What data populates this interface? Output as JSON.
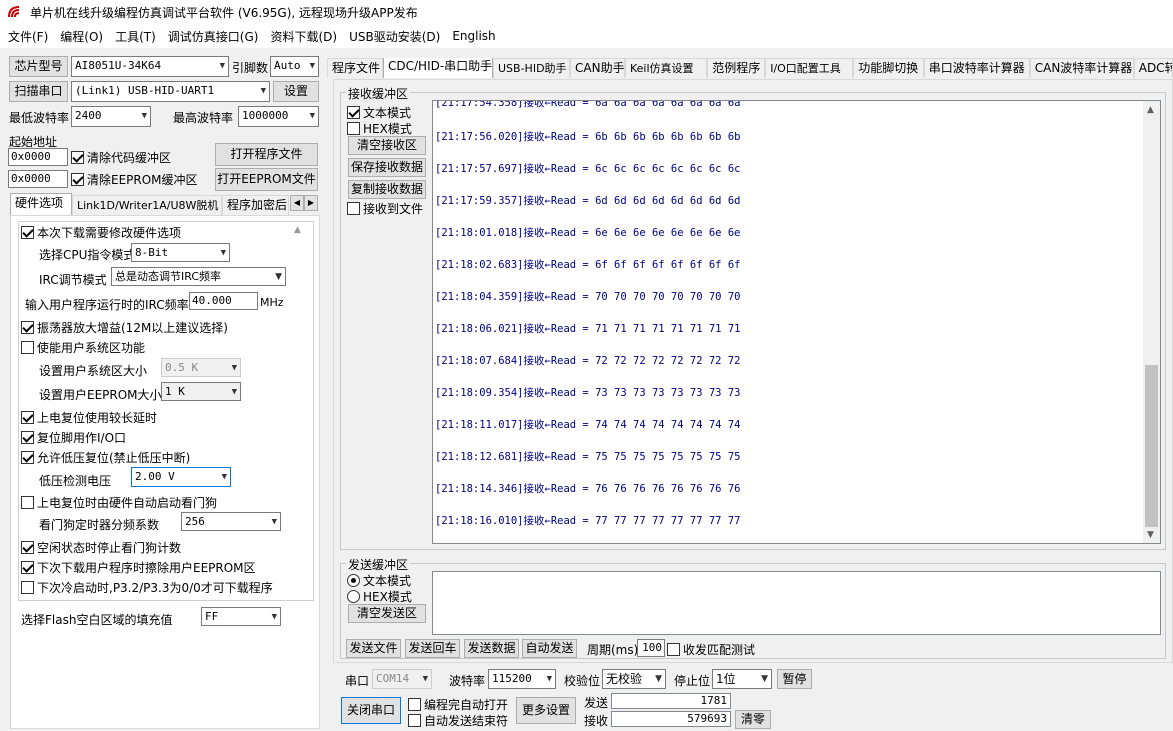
{
  "window": {
    "title": "单片机在线升级编程仿真调试平台软件 (V6.95G), 远程现场升级APP发布"
  },
  "menu": [
    "文件(F)",
    "编程(O)",
    "工具(T)",
    "调试仿真接口(G)",
    "资料下载(D)",
    "USB驱动安装(D)",
    "English"
  ],
  "left": {
    "chip_label": "芯片型号",
    "chip_value": "AI8051U-34K64",
    "pin_label": "引脚数",
    "pin_value": "Auto",
    "scan_button": "扫描串口",
    "port_value": "(Link1) USB-HID-UART1",
    "settings_button": "设置",
    "min_baud_label": "最低波特率",
    "min_baud_value": "2400",
    "max_baud_label": "最高波特率",
    "max_baud_value": "1000000",
    "start_addr_label": "起始地址",
    "addr1": "0x0000",
    "clear_code_label": "清除代码缓冲区",
    "open_prog_button": "打开程序文件",
    "addr2": "0x0000",
    "clear_eeprom_label": "清除EEPROM缓冲区",
    "open_eeprom_button": "打开EEPROM文件"
  },
  "left_tabs": [
    "硬件选项",
    "Link1D/Writer1A/U8W脱机",
    "程序加密后"
  ],
  "hw": {
    "modify_hw": "本次下载需要修改硬件选项",
    "cpu_mode_label": "选择CPU指令模式",
    "cpu_mode_value": "8-Bit",
    "irc_mode_label": "IRC调节模式",
    "irc_mode_value": "总是动态调节IRC频率",
    "irc_freq_label": "输入用户程序运行时的IRC频率",
    "irc_freq_value": "40.000",
    "irc_freq_unit": "MHz",
    "osc_gain": "振荡器放大增益(12M以上建议选择)",
    "user_sys": "使能用户系统区功能",
    "sys_size_label": "设置用户系统区大小",
    "sys_size_value": "0.5 K",
    "eeprom_size_label": "设置用户EEPROM大小",
    "eeprom_size_value": "1   K",
    "long_delay": "上电复位使用较长延时",
    "reset_io": "复位脚用作I/O口",
    "lvr": "允许低压复位(禁止低压中断)",
    "lvd_label": "低压检测电压",
    "lvd_value": "2.00 V",
    "wdt_auto": "上电复位时由硬件自动启动看门狗",
    "wdt_div_label": "看门狗定时器分频系数",
    "wdt_div_value": "256",
    "idle_wdt": "空闲状态时停止看门狗计数",
    "erase_eeprom": "下次下载用户程序时擦除用户EEPROM区",
    "cold_boot": "下次冷启动时,P3.2/P3.3为0/0才可下载程序",
    "flash_fill_label": "选择Flash空白区域的填充值",
    "flash_fill_value": "FF"
  },
  "right_tabs": [
    "程序文件",
    "CDC/HID-串口助手",
    "USB-HID助手",
    "CAN助手",
    "Keil仿真设置",
    "范例程序",
    "I/O口配置工具",
    "功能脚切换",
    "串口波特率计算器",
    "CAN波特率计算器",
    "ADC转"
  ],
  "recv": {
    "group_title": "接收缓冲区",
    "text_mode": "文本模式",
    "hex_mode": "HEX模式",
    "clear_btn": "清空接收区",
    "save_btn": "保存接收数据",
    "copy_btn": "复制接收数据",
    "to_file": "接收到文件",
    "lines": [
      "[21:17:54.358]接收←Read = 6a 6a 6a 6a 6a 6a 6a 6a",
      "[21:17:56.020]接收←Read = 6b 6b 6b 6b 6b 6b 6b 6b",
      "[21:17:57.697]接收←Read = 6c 6c 6c 6c 6c 6c 6c 6c",
      "[21:17:59.357]接收←Read = 6d 6d 6d 6d 6d 6d 6d 6d",
      "[21:18:01.018]接收←Read = 6e 6e 6e 6e 6e 6e 6e 6e",
      "[21:18:02.683]接收←Read = 6f 6f 6f 6f 6f 6f 6f 6f",
      "[21:18:04.359]接收←Read = 70 70 70 70 70 70 70 70",
      "[21:18:06.021]接收←Read = 71 71 71 71 71 71 71 71",
      "[21:18:07.684]接收←Read = 72 72 72 72 72 72 72 72",
      "[21:18:09.354]接收←Read = 73 73 73 73 73 73 73 73",
      "[21:18:11.017]接收←Read = 74 74 74 74 74 74 74 74",
      "[21:18:12.681]接收←Read = 75 75 75 75 75 75 75 75",
      "[21:18:14.346]接收←Read = 76 76 76 76 76 76 76 76",
      "[21:18:16.010]接收←Read = 77 77 77 77 77 77 77 77"
    ]
  },
  "send": {
    "group_title": "发送缓冲区",
    "text_mode": "文本模式",
    "hex_mode": "HEX模式",
    "clear_btn": "清空发送区",
    "send_file": "发送文件",
    "send_return": "发送回车",
    "send_data": "发送数据",
    "auto_send": "自动发送",
    "period_label": "周期(ms)",
    "period_value": "100",
    "match_test": "收发匹配测试"
  },
  "port": {
    "port_label": "串口",
    "port_value": "COM14",
    "baud_label": "波特率",
    "baud_value": "115200",
    "parity_label": "校验位",
    "parity_value": "无校验",
    "stop_label": "停止位",
    "stop_value": "1位",
    "pause_btn": "暂停",
    "close_btn": "关闭串口",
    "auto_open": "编程完自动打开",
    "auto_send_end": "自动发送结束符",
    "more_btn": "更多设置",
    "sent_label": "发送",
    "sent_count": "1781",
    "recv_label": "接收",
    "recv_count": "579693",
    "clear_btn": "清零"
  }
}
